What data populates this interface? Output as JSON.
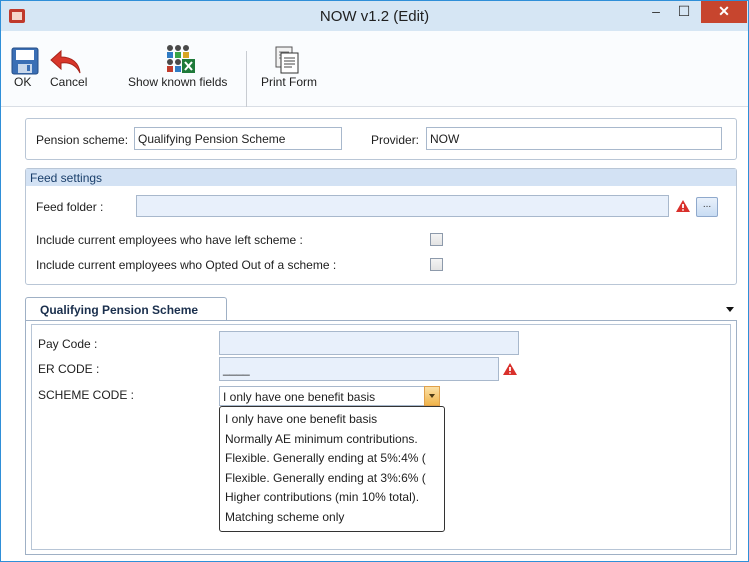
{
  "window": {
    "title": "NOW v1.2 (Edit)",
    "minimize": "–",
    "maximize": "☐",
    "close": "✕"
  },
  "toolbar": {
    "ok_label": "OK",
    "cancel_label": "Cancel",
    "show_known_fields_label": "Show known fields",
    "print_form_label": "Print Form"
  },
  "scheme": {
    "pension_label": "Pension scheme:",
    "pension_value": "Qualifying Pension Scheme",
    "provider_label": "Provider:",
    "provider_value": "NOW"
  },
  "feed": {
    "header": "Feed settings",
    "folder_label": "Feed folder :",
    "folder_value": "",
    "browse_label": "...",
    "left_scheme_label": "Include current employees who have left scheme :",
    "opted_out_label": "Include current employees who Opted Out of a scheme :"
  },
  "tab": {
    "label": "Qualifying Pension Scheme"
  },
  "fields": {
    "pay_code_label": "Pay Code :",
    "pay_code_value": "",
    "er_code_label": "ER CODE :",
    "er_code_value": "____",
    "scheme_code_label": "SCHEME CODE :",
    "scheme_code_value": "I only have one benefit basis"
  },
  "dropdown": {
    "options": [
      "I only have one benefit basis",
      "Normally AE minimum contributions.",
      "Flexible. Generally ending at 5%:4% (",
      "Flexible. Generally ending at 3%:6% (",
      "Higher contributions (min 10% total).",
      "Matching scheme only"
    ]
  },
  "colors": {
    "accent": "#2f8fd8",
    "close": "#c7452e",
    "warning": "#d9302b"
  }
}
